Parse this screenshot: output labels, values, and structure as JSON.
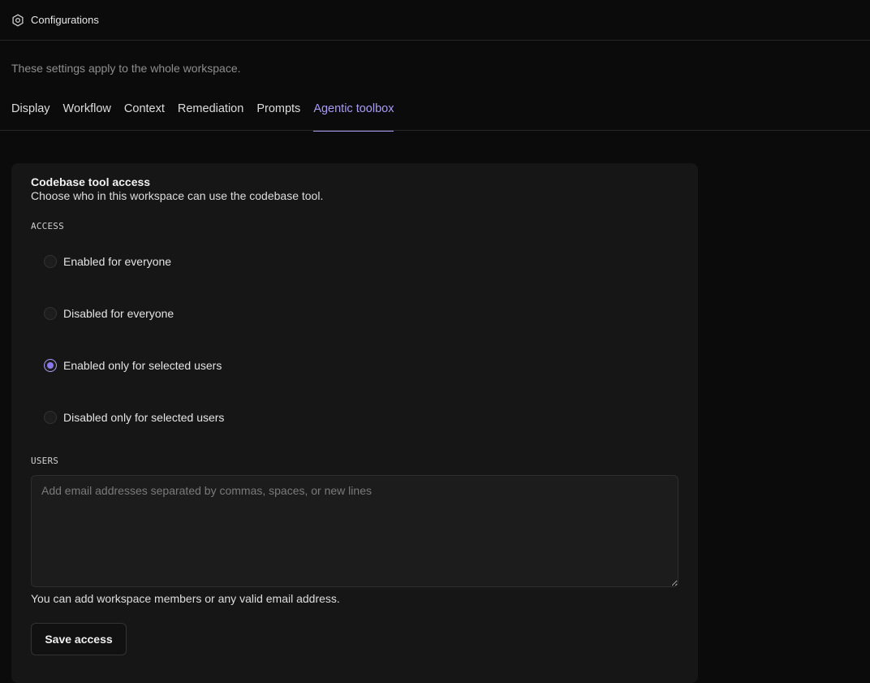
{
  "header": {
    "icon": "settings-hexagon-icon",
    "title": "Configurations"
  },
  "subtitle": "These settings apply to the whole workspace.",
  "tabs": [
    {
      "label": "Display",
      "active": false
    },
    {
      "label": "Workflow",
      "active": false
    },
    {
      "label": "Context",
      "active": false
    },
    {
      "label": "Remediation",
      "active": false
    },
    {
      "label": "Prompts",
      "active": false
    },
    {
      "label": "Agentic toolbox",
      "active": true
    }
  ],
  "card": {
    "title": "Codebase tool access",
    "description": "Choose who in this workspace can use the codebase tool.",
    "access_label": "ACCESS",
    "options": [
      {
        "label": "Enabled for everyone",
        "checked": false
      },
      {
        "label": "Disabled for everyone",
        "checked": false
      },
      {
        "label": "Enabled only for selected users",
        "checked": true
      },
      {
        "label": "Disabled only for selected users",
        "checked": false
      }
    ],
    "users_label": "USERS",
    "users_value": "",
    "users_placeholder": "Add email addresses separated by commas, spaces, or new lines",
    "helper": "You can add workspace members or any valid email address.",
    "save_label": "Save access"
  },
  "colors": {
    "accent": "#a99cf4",
    "background": "#0b0b0b",
    "card": "#161616"
  }
}
